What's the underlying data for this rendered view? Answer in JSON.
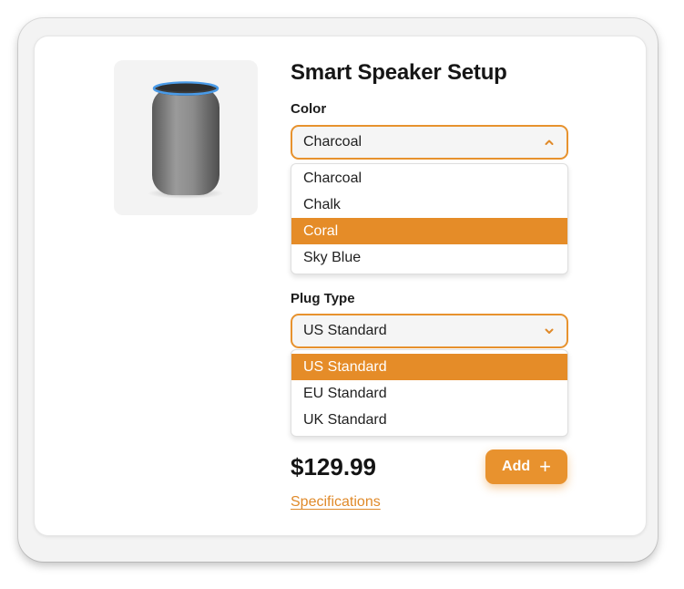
{
  "product": {
    "title": "Smart Speaker Setup",
    "image_alt": "smart speaker",
    "price": "$129.99"
  },
  "color": {
    "label": "Color",
    "selected": "Charcoal",
    "options": [
      "Charcoal",
      "Chalk",
      "Coral",
      "Sky Blue"
    ],
    "highlighted": "Coral",
    "expanded_icon": "chevron-up-icon"
  },
  "plug": {
    "label": "Plug Type",
    "selected": "US Standard",
    "options": [
      "US Standard",
      "EU Standard",
      "UK Standard"
    ],
    "highlighted": "US Standard",
    "expanded_icon": "chevron-down-icon"
  },
  "actions": {
    "add_label": "Add",
    "add_icon": "plus-icon",
    "specs_link": "Specifications"
  },
  "colors": {
    "accent": "#E8922E",
    "highlight": "#E58C28",
    "text": "#161616",
    "speaker_light": "#4A9BE8"
  }
}
